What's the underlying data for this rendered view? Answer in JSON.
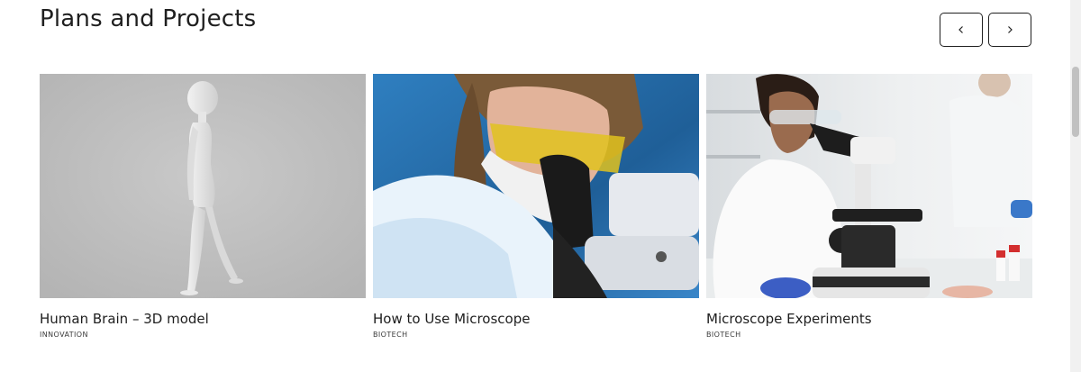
{
  "section": {
    "title": "Plans and Projects"
  },
  "carousel": {
    "prev_icon": "chevron-left-icon",
    "next_icon": "chevron-right-icon"
  },
  "cards": [
    {
      "title": "Human Brain – 3D model",
      "category": "INNOVATION",
      "image_icon": "3d-human-figure-image"
    },
    {
      "title": "How to Use Microscope",
      "category": "BIOTECH",
      "image_icon": "scientist-microscope-image"
    },
    {
      "title": "Microscope Experiments",
      "category": "BIOTECH",
      "image_icon": "lab-microscope-image"
    }
  ],
  "colors": {
    "text": "#1e1e1e",
    "button_border": "#1f1f1f",
    "background": "#ffffff"
  }
}
